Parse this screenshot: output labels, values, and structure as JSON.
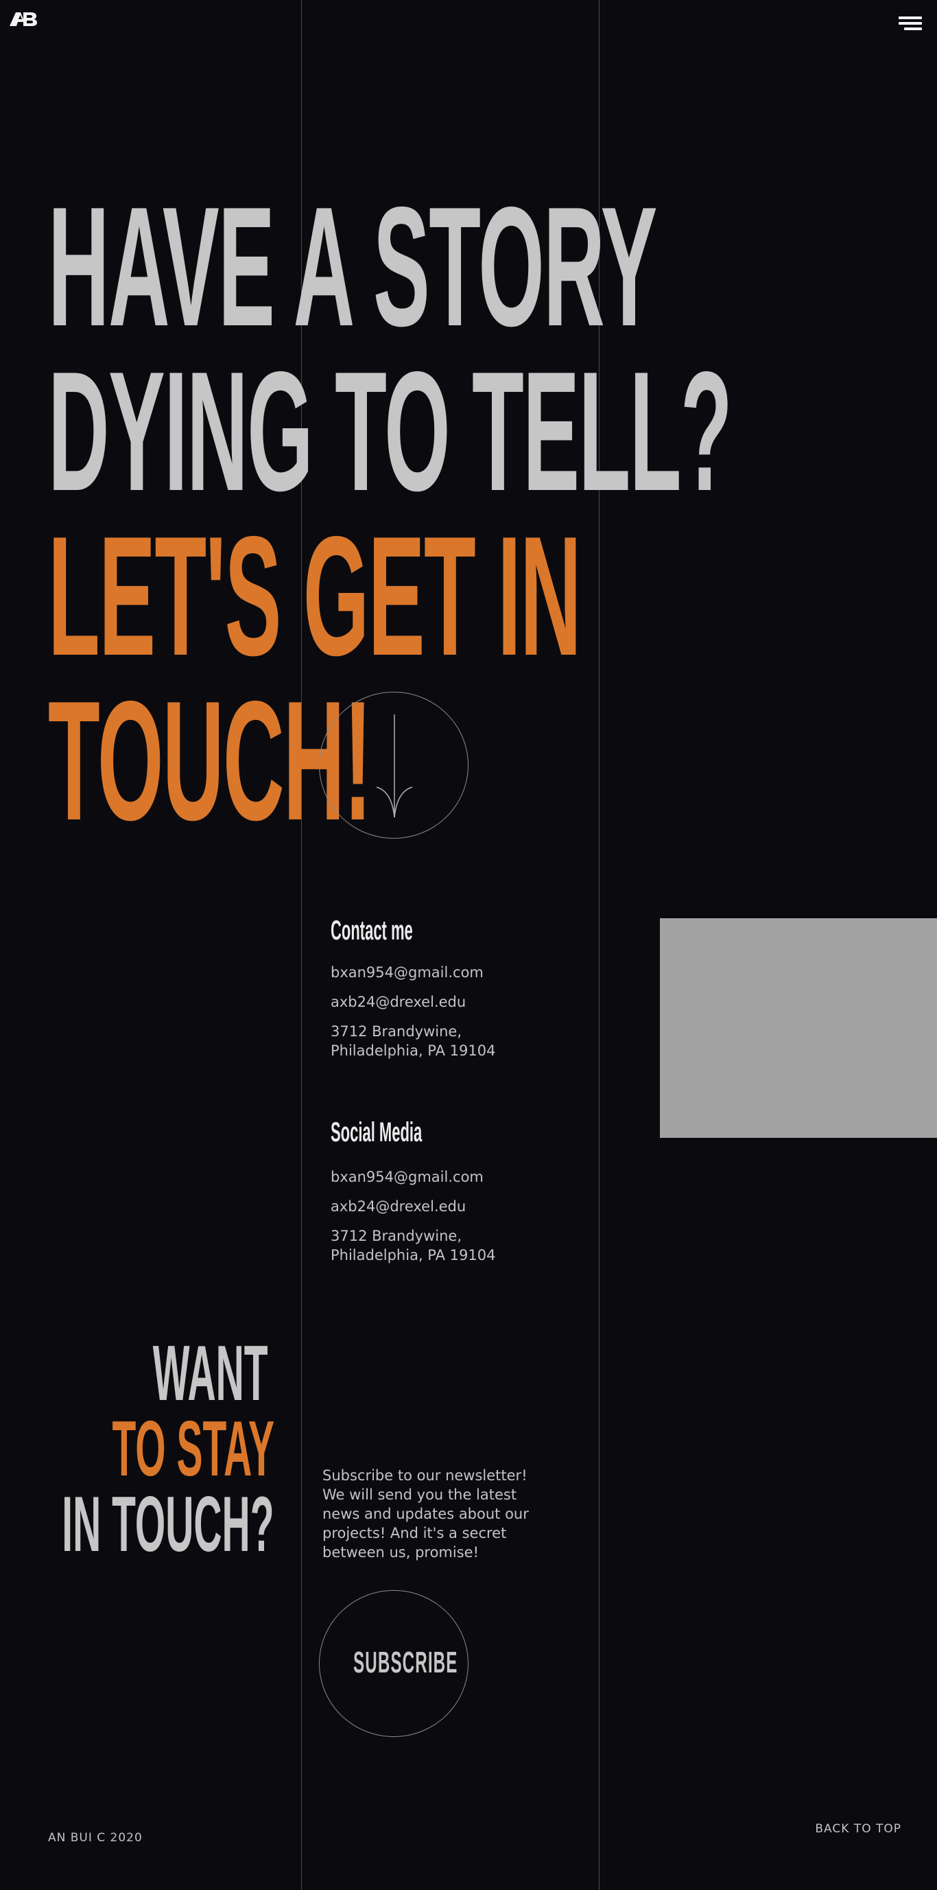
{
  "header": {
    "logo_icon": "ab-logo-icon",
    "menu_icon": "hamburger-menu-icon"
  },
  "hero": {
    "line1": "HAVE A STORY",
    "line2": "DYING TO TELL?",
    "line3": "LET'S GET IN",
    "line4": "TOUCH!",
    "arrow_icon": "arrow-down-icon"
  },
  "contact": {
    "heading": "Contact me",
    "email1": "bxan954@gmail.com",
    "email2": "axb24@drexel.edu",
    "address_line1": "3712 Brandywine,",
    "address_line2": "Philadelphia, PA 19104"
  },
  "social": {
    "heading": "Social Media",
    "email1": "bxan954@gmail.com",
    "email2": "axb24@drexel.edu",
    "address_line1": "3712 Brandywine,",
    "address_line2": "Philadelphia, PA 19104"
  },
  "newsletter": {
    "title_line1": "WANT",
    "title_line2": "TO STAY",
    "title_line3": "IN TOUCH?",
    "text": "Subscribe to our newsletter! We will send you the latest news and updates about our projects! And it's a secret between us, promise!",
    "subscribe_label": "SUBSCRIBE"
  },
  "footer": {
    "copyright": "AN BUI C 2020",
    "back_to_top": "BACK TO TOP"
  },
  "colors": {
    "background": "#0b0b0f",
    "accent": "#db772b",
    "text_light": "#c6c6c6",
    "placeholder_box": "#a2a2a2"
  }
}
